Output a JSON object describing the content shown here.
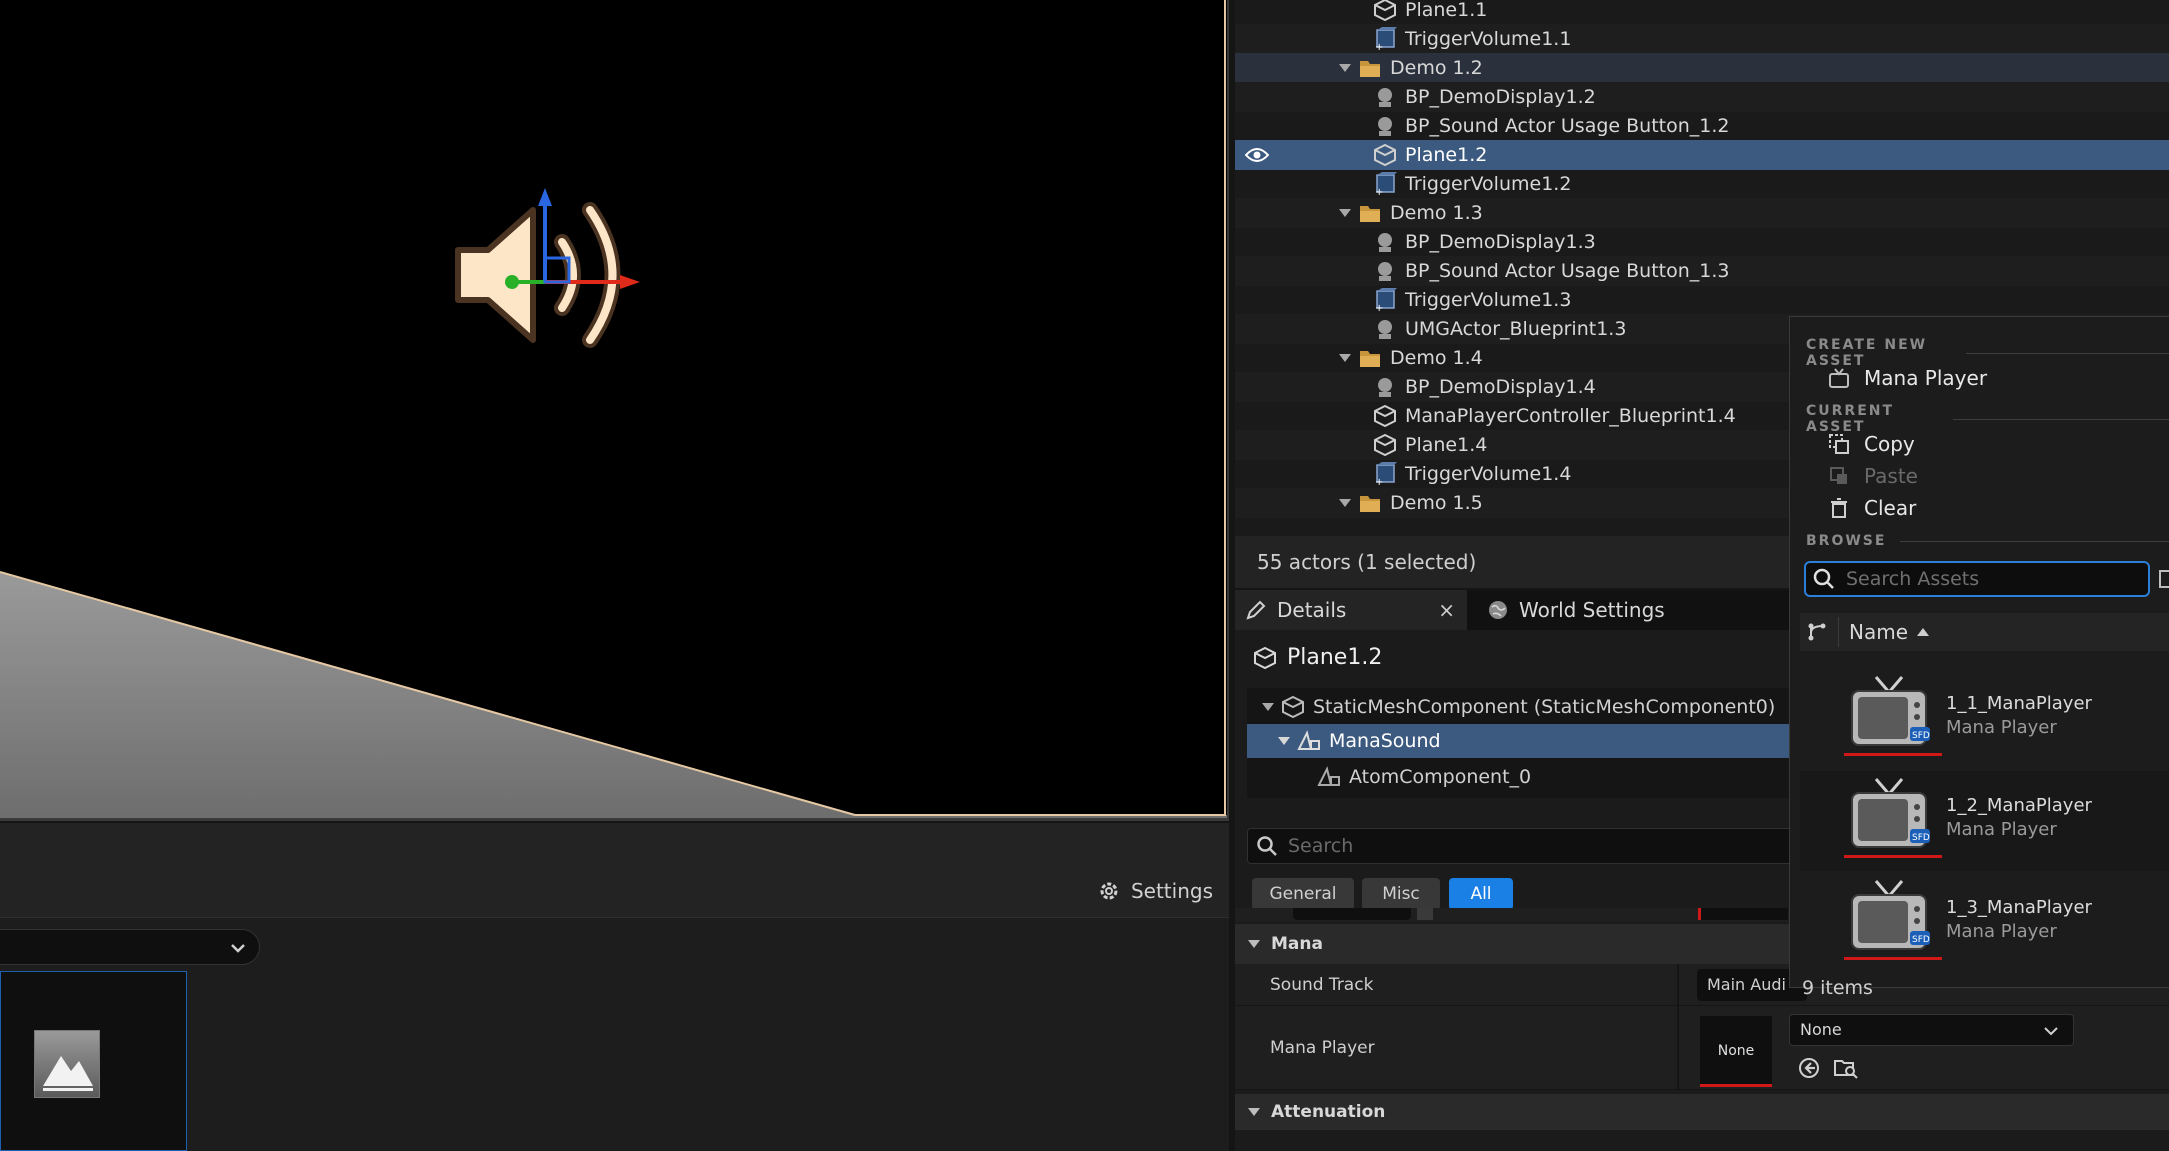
{
  "outliner": {
    "rows": [
      {
        "label": "Plane1.1",
        "icon": "static-mesh-icon",
        "indent": 2
      },
      {
        "label": "TriggerVolume1.1",
        "icon": "trigger-volume-icon",
        "indent": 2
      },
      {
        "label": "Demo 1.2",
        "icon": "folder-icon",
        "indent": 1
      },
      {
        "label": "BP_DemoDisplay1.2",
        "icon": "actor-icon",
        "indent": 2
      },
      {
        "label": "BP_Sound Actor Usage Button_1.2",
        "icon": "actor-icon",
        "indent": 2
      },
      {
        "label": "Plane1.2",
        "icon": "static-mesh-icon",
        "indent": 2
      },
      {
        "label": "TriggerVolume1.2",
        "icon": "trigger-volume-icon",
        "indent": 2
      },
      {
        "label": "Demo 1.3",
        "icon": "folder-icon",
        "indent": 1
      },
      {
        "label": "BP_DemoDisplay1.3",
        "icon": "actor-icon",
        "indent": 2
      },
      {
        "label": "BP_Sound Actor Usage Button_1.3",
        "icon": "actor-icon",
        "indent": 2
      },
      {
        "label": "TriggerVolume1.3",
        "icon": "trigger-volume-icon",
        "indent": 2
      },
      {
        "label": "UMGActor_Blueprint1.3",
        "icon": "actor-icon",
        "indent": 2
      },
      {
        "label": "Demo 1.4",
        "icon": "folder-icon",
        "indent": 1
      },
      {
        "label": "BP_DemoDisplay1.4",
        "icon": "actor-icon",
        "indent": 2
      },
      {
        "label": "ManaPlayerController_Blueprint1.4",
        "icon": "static-mesh-icon",
        "indent": 2
      },
      {
        "label": "Plane1.4",
        "icon": "static-mesh-icon",
        "indent": 2
      },
      {
        "label": "TriggerVolume1.4",
        "icon": "trigger-volume-icon",
        "indent": 2
      },
      {
        "label": "Demo 1.5",
        "icon": "folder-icon",
        "indent": 1
      }
    ],
    "status": "55 actors (1 selected)"
  },
  "content_browser": {
    "settings_label": "Settings"
  },
  "details": {
    "tab_details": "Details",
    "tab_world_settings": "World Settings",
    "actor_name": "Plane1.2",
    "components": [
      "StaticMeshComponent (StaticMeshComponent0)",
      "ManaSound",
      "AtomComponent_0"
    ],
    "search_placeholder": "Search",
    "filters": [
      "General",
      "Misc",
      "All"
    ],
    "category_mana": "Mana",
    "category_attenuation": "Attenuation",
    "prop_sound_track": "Sound Track",
    "prop_sound_track_value": "Main Audi",
    "prop_mana_player": "Mana Player",
    "prop_mana_player_thumb": "None",
    "prop_mana_player_value": "None"
  },
  "picker": {
    "create_new_asset": "CREATE NEW ASSET",
    "new_mana_player": "Mana Player",
    "current_asset": "CURRENT ASSET",
    "copy": "Copy",
    "paste": "Paste",
    "clear": "Clear",
    "browse": "BROWSE",
    "search_placeholder": "Search Assets",
    "column_name": "Name",
    "assets": [
      {
        "name": "1_1_ManaPlayer",
        "type": "Mana Player",
        "badge": "SFD"
      },
      {
        "name": "1_2_ManaPlayer",
        "type": "Mana Player",
        "badge": "SFD"
      },
      {
        "name": "1_3_ManaPlayer",
        "type": "Mana Player",
        "badge": "SFD"
      }
    ],
    "item_count": "9 items"
  },
  "colors": {
    "selection": "#3c5a7f",
    "accent_blue": "#1a80e6",
    "folder": "#c8943c",
    "red_underline": "#d01818"
  }
}
